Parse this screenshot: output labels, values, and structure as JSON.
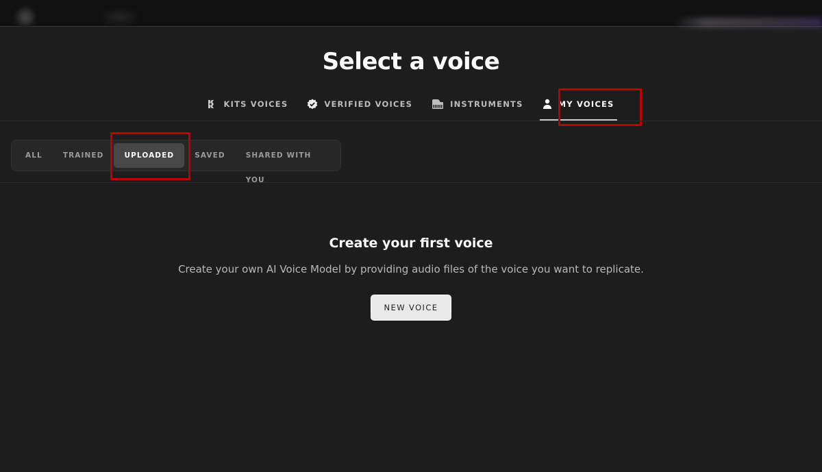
{
  "header": {
    "title": "Select a voice"
  },
  "tabs": [
    {
      "label": "KITS VOICES",
      "icon": "kits-logo-icon",
      "active": false
    },
    {
      "label": "VERIFIED VOICES",
      "icon": "verified-badge-icon",
      "active": false
    },
    {
      "label": "INSTRUMENTS",
      "icon": "piano-icon",
      "active": false
    },
    {
      "label": "MY VOICES",
      "icon": "user-icon",
      "active": true
    }
  ],
  "subtabs": [
    {
      "label": "ALL",
      "active": false
    },
    {
      "label": "TRAINED",
      "active": false
    },
    {
      "label": "UPLOADED",
      "active": true
    },
    {
      "label": "SAVED",
      "active": false
    },
    {
      "label": "SHARED WITH YOU",
      "active": false
    }
  ],
  "empty_state": {
    "heading": "Create your first voice",
    "description": "Create your own AI Voice Model by providing audio files of the voice you want to replicate.",
    "button_label": "NEW VOICE"
  },
  "colors": {
    "highlight": "#c00000",
    "background": "#1d1d1e",
    "active_subtab": "#474748"
  }
}
